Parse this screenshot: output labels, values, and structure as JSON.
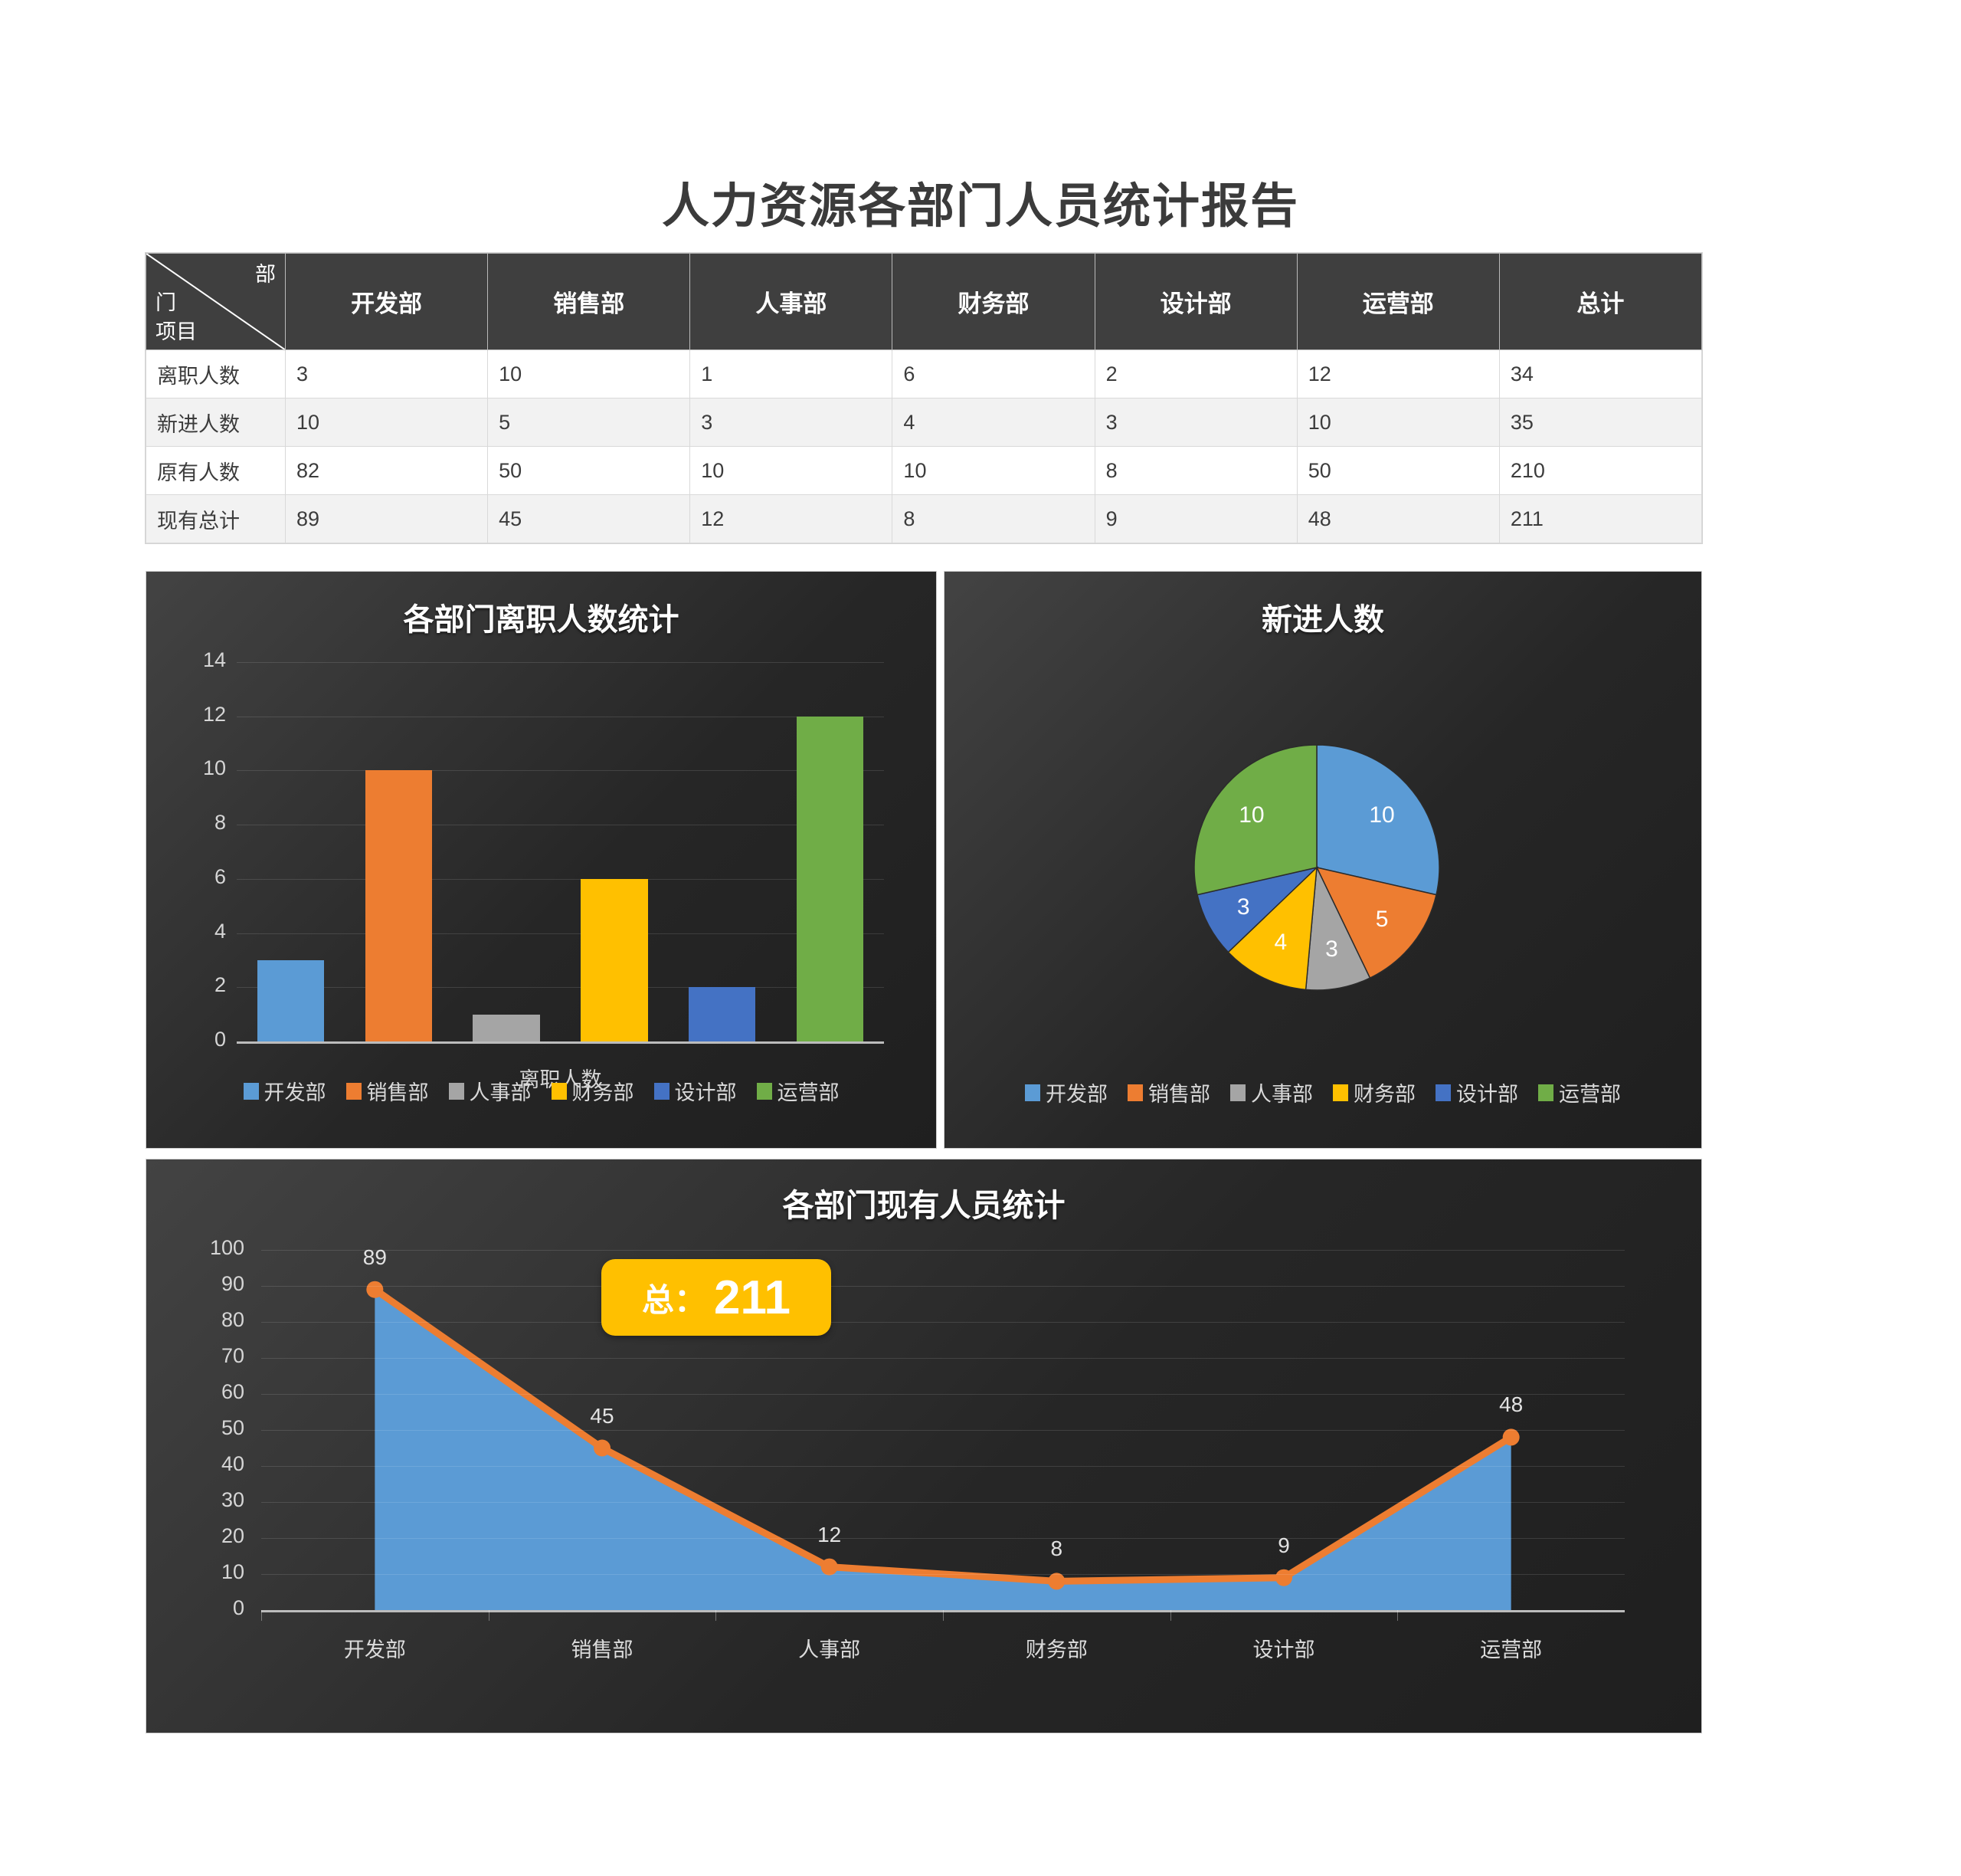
{
  "report": {
    "title": "人力资源各部门人员统计报告"
  },
  "table": {
    "corner": {
      "top_right": "部",
      "bottom_left_1": "门",
      "bottom_left_2": "项目"
    },
    "columns": [
      "开发部",
      "销售部",
      "人事部",
      "财务部",
      "设计部",
      "运营部",
      "总计"
    ],
    "rows": [
      {
        "label": "离职人数",
        "values": [
          "3",
          "10",
          "1",
          "6",
          "2",
          "12",
          "34"
        ]
      },
      {
        "label": "新进人数",
        "values": [
          "10",
          "5",
          "3",
          "4",
          "3",
          "10",
          "35"
        ]
      },
      {
        "label": "原有人数",
        "values": [
          "82",
          "50",
          "10",
          "10",
          "8",
          "50",
          "210"
        ]
      },
      {
        "label": "现有总计",
        "values": [
          "89",
          "45",
          "12",
          "8",
          "9",
          "48",
          "211"
        ]
      }
    ]
  },
  "colors": {
    "blue": "#5B9BD5",
    "orange": "#ED7D31",
    "gray": "#A5A5A5",
    "yellow": "#FFC000",
    "darkblue": "#4472C4",
    "green": "#70AD47",
    "panel_dark": "#2b2b2b",
    "header_dark": "#3f3f3f",
    "badge": "#FFC000"
  },
  "legend": {
    "items": [
      {
        "label": "开发部",
        "color": "#5B9BD5"
      },
      {
        "label": "销售部",
        "color": "#ED7D31"
      },
      {
        "label": "人事部",
        "color": "#A5A5A5"
      },
      {
        "label": "财务部",
        "color": "#FFC000"
      },
      {
        "label": "设计部",
        "color": "#4472C4"
      },
      {
        "label": "运营部",
        "color": "#70AD47"
      }
    ]
  },
  "total_badge": {
    "label": "总：",
    "value": "211"
  },
  "chart_data": [
    {
      "type": "bar",
      "title": "各部门离职人数统计",
      "xlabel": "离职人数",
      "ylabel": "",
      "categories": [
        "开发部",
        "销售部",
        "人事部",
        "财务部",
        "设计部",
        "运营部"
      ],
      "values": [
        3,
        10,
        1,
        6,
        2,
        12
      ],
      "colors": [
        "#5B9BD5",
        "#ED7D31",
        "#A5A5A5",
        "#FFC000",
        "#4472C4",
        "#70AD47"
      ],
      "ylim": [
        0,
        14
      ],
      "yticks": [
        0,
        2,
        4,
        6,
        8,
        10,
        12,
        14
      ],
      "grid": true,
      "legend_position": "bottom"
    },
    {
      "type": "pie",
      "title": "新进人数",
      "labels": [
        "开发部",
        "销售部",
        "人事部",
        "财务部",
        "设计部",
        "运营部"
      ],
      "values": [
        10,
        5,
        3,
        4,
        3,
        10
      ],
      "total": 35,
      "colors": [
        "#5B9BD5",
        "#ED7D31",
        "#A5A5A5",
        "#FFC000",
        "#4472C4",
        "#70AD47"
      ],
      "start_angle_deg": 0,
      "legend_position": "bottom"
    },
    {
      "type": "area",
      "title": "各部门现有人员统计",
      "categories": [
        "开发部",
        "销售部",
        "人事部",
        "财务部",
        "设计部",
        "运营部"
      ],
      "values": [
        89,
        45,
        12,
        8,
        9,
        48
      ],
      "ylim": [
        0,
        100
      ],
      "yticks": [
        0,
        10,
        20,
        30,
        40,
        50,
        60,
        70,
        80,
        90,
        100
      ],
      "area_color": "#5B9BD5",
      "line_color": "#ED7D31",
      "grid": true,
      "xlabel": "",
      "ylabel": "",
      "legend_position": "none"
    }
  ]
}
